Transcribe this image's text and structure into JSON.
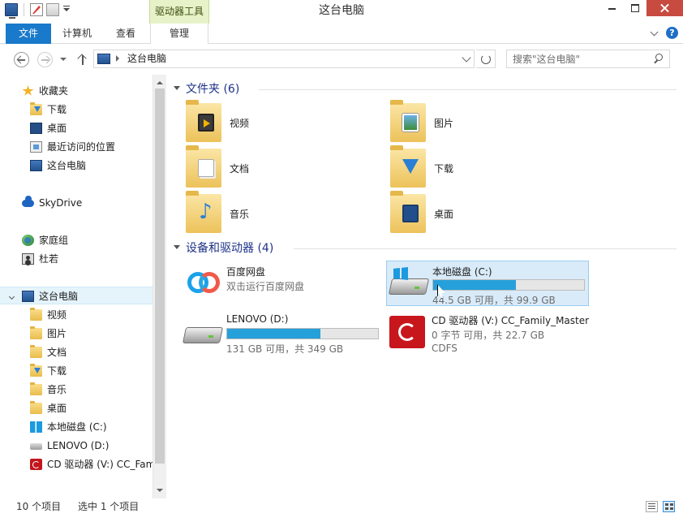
{
  "window": {
    "title": "这台电脑",
    "context_tab_group": "驱动器工具"
  },
  "ribbon": {
    "tabs": [
      {
        "label": "文件",
        "active": true
      },
      {
        "label": "计算机"
      },
      {
        "label": "查看"
      },
      {
        "label": "管理"
      }
    ],
    "help_label": "?"
  },
  "address": {
    "breadcrumb": "这台电脑",
    "search_placeholder": "搜索\"这台电脑\""
  },
  "nav": {
    "favorites": "收藏夹",
    "fav_items": [
      "下载",
      "桌面",
      "最近访问的位置",
      "这台电脑"
    ],
    "skydrive": "SkyDrive",
    "homegroup": "家庭组",
    "home_user": "杜若",
    "this_pc": "这台电脑",
    "pc_items": [
      "视频",
      "图片",
      "文档",
      "下载",
      "音乐",
      "桌面",
      "本地磁盘 (C:)",
      "LENOVO (D:)",
      "CD 驱动器 (V:) CC_Family_Master"
    ]
  },
  "content": {
    "folders_header": "文件夹 (6)",
    "folders": [
      "视频",
      "图片",
      "文档",
      "下载",
      "音乐",
      "桌面"
    ],
    "devices_header": "设备和驱动器 (4)",
    "devices": {
      "baidu": {
        "name": "百度网盘",
        "sub": "双击运行百度网盘"
      },
      "c": {
        "name": "本地磁盘 (C:)",
        "free": "44.5 GB 可用，共 99.9 GB",
        "used_fraction": 0.55
      },
      "d": {
        "name": "LENOVO (D:)",
        "free": "131 GB 可用，共 349 GB",
        "used_fraction": 0.62
      },
      "cd": {
        "name": "CD 驱动器 (V:) CC_Family_Master",
        "free": "0 字节 可用，共 22.7 GB",
        "fs": "CDFS"
      }
    }
  },
  "status": {
    "items": "10 个项目",
    "selected": "选中 1 个项目"
  },
  "colors": {
    "accent": "#1979ca",
    "context_tab": "#e7f2c9",
    "group_header": "#1e3287",
    "usage_bar": "#26a0da",
    "selection": "#d9ebf9"
  }
}
